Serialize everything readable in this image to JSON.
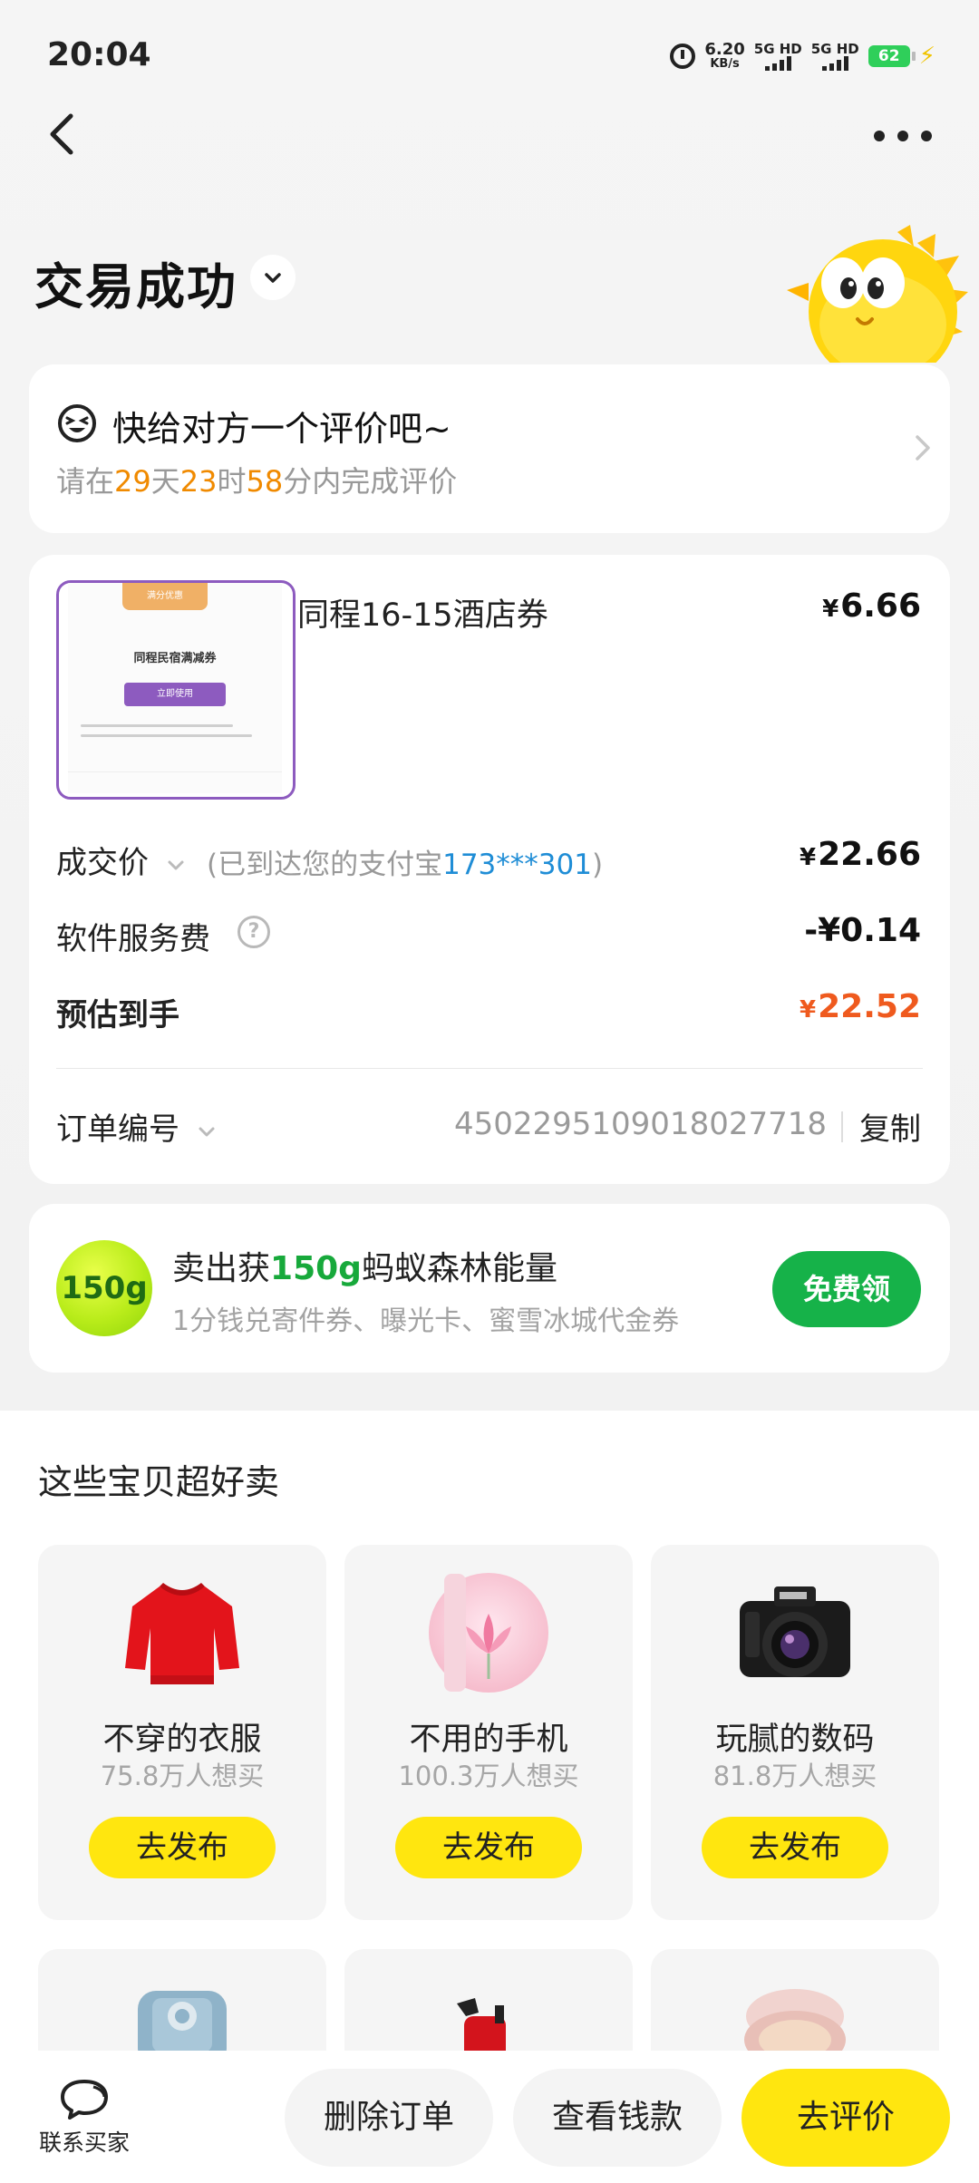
{
  "status_bar": {
    "time": "20:04",
    "net_speed_value": "6.20",
    "net_speed_unit": "KB/s",
    "sim1": "5G HD",
    "sim2": "5G HD",
    "battery": "62"
  },
  "header": {
    "title": "交易成功"
  },
  "review": {
    "title": "快给对方一个评价吧~",
    "prefix": "请在",
    "days": "29",
    "days_unit": "天",
    "hours": "23",
    "hours_unit": "时",
    "minutes": "58",
    "minutes_unit": "分内完成评价"
  },
  "order": {
    "thumb": {
      "tag": "满分优惠",
      "title": "同程民宿满减券",
      "button": "立即使用"
    },
    "product_title": "同程16-15酒店券",
    "product_price": "6.66",
    "currency": "¥",
    "deal_label": "成交价",
    "deal_note_prefix": "(已到达您的支付宝",
    "deal_note_account": "173***301",
    "deal_note_suffix": ")",
    "deal_price": "22.66",
    "fee_label": "软件服务费",
    "fee_value": "-¥0.14",
    "estimate_label": "预估到手",
    "estimate_value": "22.52",
    "order_no_label": "订单编号",
    "order_no": "4502295109018027718",
    "copy_label": "复制"
  },
  "energy": {
    "badge": "150g",
    "title_prefix": "卖出获",
    "title_amount": "150g",
    "title_suffix": "蚂蚁森林能量",
    "subtitle": "1分钱兑寄件券、曝光卡、蜜雪冰城代金券",
    "button": "免费领"
  },
  "recommend": {
    "heading": "这些宝贝超好卖",
    "items": [
      {
        "name": "不穿的衣服",
        "count": "75.8万人想买",
        "button": "去发布",
        "icon": "sweater-icon"
      },
      {
        "name": "不用的手机",
        "count": "100.3万人想买",
        "button": "去发布",
        "icon": "phone-icon"
      },
      {
        "name": "玩腻的数码",
        "count": "81.8万人想买",
        "button": "去发布",
        "icon": "camera-icon"
      }
    ]
  },
  "bottom_bar": {
    "contact_label": "联系买家",
    "delete_label": "删除订单",
    "view_label": "查看钱款",
    "review_label": "去评价"
  },
  "colors": {
    "accent_yellow": "#ffe60f",
    "green": "#16b249",
    "orange": "#f08a00",
    "red_value": "#ef5a1e",
    "link_blue": "#1f8dd6"
  }
}
